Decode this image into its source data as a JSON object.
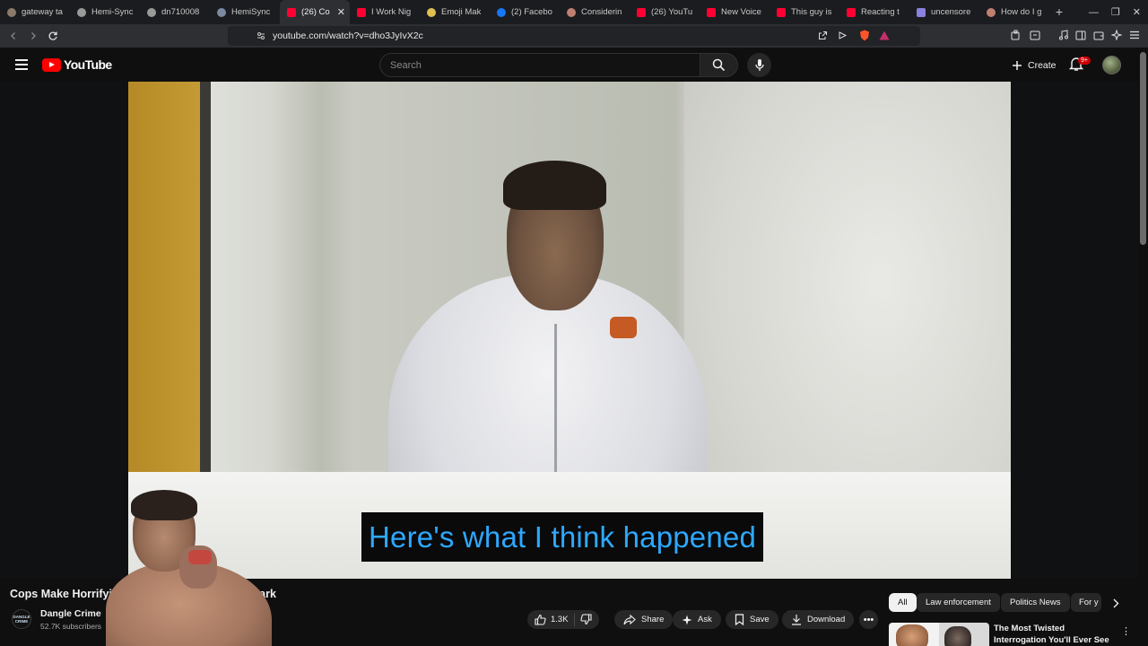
{
  "browser": {
    "tabs": [
      {
        "label": "gateway ta",
        "color": "#8a7a6a"
      },
      {
        "label": "Hemi-Sync",
        "color": "#9a9a9a"
      },
      {
        "label": "dn710008",
        "color": "#9a9a9a"
      },
      {
        "label": "HemiSync",
        "color": "#7a8aa0"
      },
      {
        "label": "(26) Co",
        "color": "#ff0033"
      },
      {
        "label": "I Work Nig",
        "color": "#ff0033"
      },
      {
        "label": "Emoji Mak",
        "color": "#e0c050"
      },
      {
        "label": "(2) Facebo",
        "color": "#1877f2"
      },
      {
        "label": "Considerin",
        "color": "#c08070"
      },
      {
        "label": "(26) YouTu",
        "color": "#ff0033"
      },
      {
        "label": "New Voice",
        "color": "#ff0033"
      },
      {
        "label": "This guy is",
        "color": "#ff0033"
      },
      {
        "label": "Reacting t",
        "color": "#ff0033"
      },
      {
        "label": "uncensore",
        "color": "#8a80e0"
      },
      {
        "label": "How do I g",
        "color": "#c08070"
      }
    ],
    "url": "youtube.com/watch?v=dho3JyIvX2c"
  },
  "youtube": {
    "logo_text": "YouTube",
    "search_placeholder": "Search",
    "create_label": "Create",
    "notification_badge": "9+"
  },
  "video": {
    "caption": "Here's what I think happened",
    "title_start": "Cops Make Horrifyi",
    "title_end": "ren's Park",
    "channel_logo_text": "DANGLE CRIME",
    "channel_name": "Dangle Crime",
    "subscribers": "52.7K subscribers",
    "like_count": "1.3K",
    "share_label": "Share",
    "ask_label": "Ask",
    "save_label": "Save",
    "download_label": "Download"
  },
  "sidebar": {
    "chips": [
      "All",
      "Law enforcement",
      "Politics News",
      "For y"
    ],
    "recommended_title": "The Most Twisted Interrogation You'll Ever See"
  }
}
